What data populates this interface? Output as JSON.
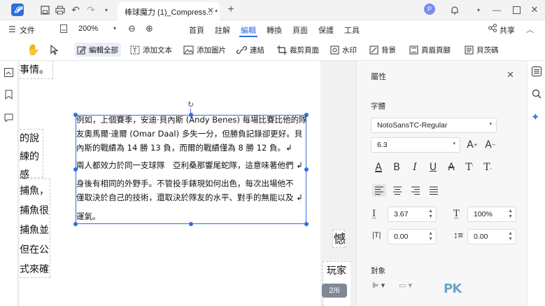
{
  "window": {
    "tab_title": "棒球魔力 (1)_Compress... *",
    "avatar_letter": "P"
  },
  "menu": {
    "file_label": "文件",
    "zoom": "200%",
    "tabs": [
      "首頁",
      "註解",
      "編輯",
      "轉換",
      "頁面",
      "保護",
      "工具"
    ],
    "active_tab": "編輯",
    "share_label": "共享"
  },
  "toolbar": {
    "edit_all": "編輯全部",
    "add_text": "添加文本",
    "add_image": "添加圖片",
    "link": "連結",
    "crop_page": "裁剪頁面",
    "watermark": "水印",
    "background": "背景",
    "header_footer": "頁眉頁腳",
    "bates": "貝茨碼"
  },
  "document": {
    "frag_top": "事情。",
    "frag_left_1": "的說",
    "frag_left_2": "練的感",
    "frag_left_3": "捕魚，",
    "frag_left_4": "捕魚很",
    "frag_left_5": "捕魚並",
    "frag_left_6": "但在公",
    "frag_left_7": "式來確",
    "frag_right_1": "憾",
    "frag_right_2": "玩家",
    "para_lines": [
      "例如，上個賽季，安迪·貝內斯 (Andy Benes) 每場比賽比他的隊",
      "友奧馬爾·達爾 (Omar Daal) 多失一分，但勝負記錄卻更好。貝",
      "內斯的戰績為 14 勝 13 負，而爾的戰績僅為 8 勝 12 負。↲",
      "兩人都效力於同一支球隊　亞利桑那響尾蛇隊，這意味著他們 ↲",
      "身後有相同的外野手。不管投手錶現如何出色，每次出場他不",
      "僅取決於自己的技術，還取決於隊友的水平、對手的無能以及 ↲",
      "運氣。"
    ],
    "page_indicator": "2/6"
  },
  "panel": {
    "title": "屬性",
    "font_section": "字體",
    "font_name": "NotoSansTC-Regular",
    "font_size": "6.3",
    "line_spacing": "3.67",
    "char_scale": "100%",
    "char_spacing": "0.00",
    "para_spacing": "0.00",
    "object_section": "對象"
  },
  "colors": {
    "accent": "#2f6fe0",
    "brand": "#2f6fe0"
  }
}
